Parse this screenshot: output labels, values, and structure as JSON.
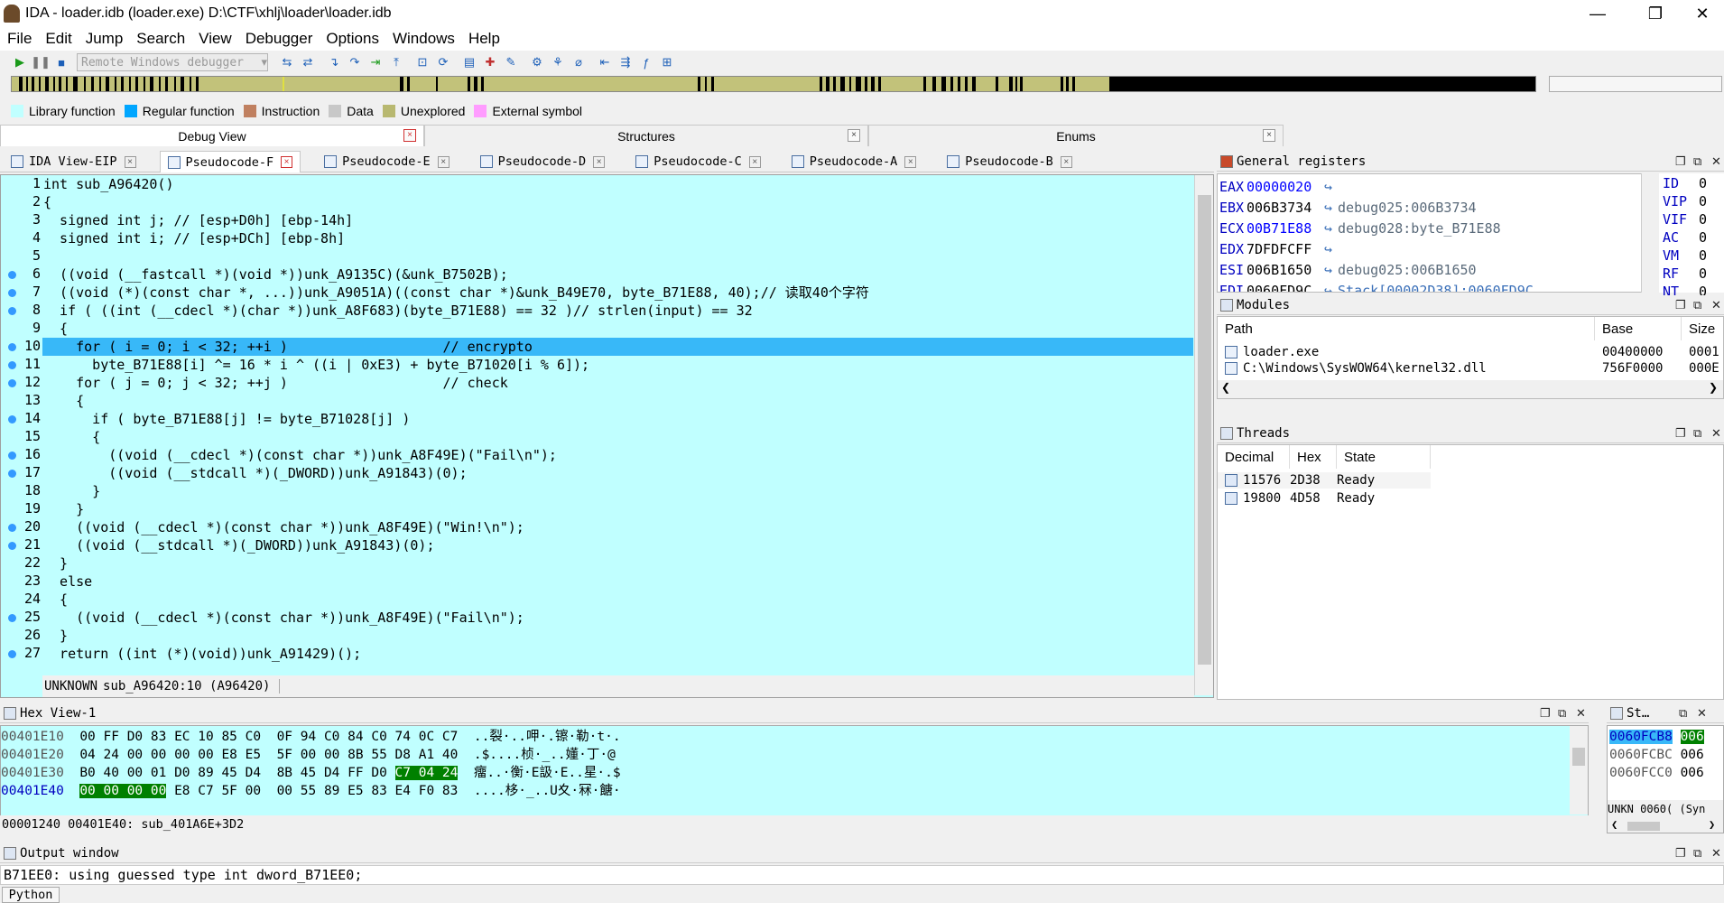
{
  "window": {
    "title": "IDA - loader.idb (loader.exe) D:\\CTF\\xhlj\\loader\\loader.idb",
    "minimize": "—",
    "maximize": "❐",
    "close": "✕"
  },
  "menu": [
    "File",
    "Edit",
    "Jump",
    "Search",
    "View",
    "Debugger",
    "Options",
    "Windows",
    "Help"
  ],
  "toolbar": {
    "debugger_select": "Remote Windows debugger"
  },
  "legend": [
    {
      "label": "Library function",
      "color": "#c0ffff"
    },
    {
      "label": "Regular function",
      "color": "#00a6ff"
    },
    {
      "label": "Instruction",
      "color": "#c08060"
    },
    {
      "label": "Data",
      "color": "#c8c8c8"
    },
    {
      "label": "Unexplored",
      "color": "#b8b870"
    },
    {
      "label": "External symbol",
      "color": "#ff9cff"
    }
  ],
  "top_tabs": [
    "Debug View",
    "Structures",
    "Enums"
  ],
  "code_tabs": [
    "IDA View-EIP",
    "Pseudocode-F",
    "Pseudocode-E",
    "Pseudocode-D",
    "Pseudocode-C",
    "Pseudocode-A",
    "Pseudocode-B"
  ],
  "code_lines": [
    "int sub_A96420()",
    "{",
    "  signed int j; // [esp+D0h] [ebp-14h]",
    "  signed int i; // [esp+DCh] [ebp-8h]",
    "",
    "  ((void (__fastcall *)(void *))unk_A9135C)(&unk_B7502B);",
    "  ((void (*)(const char *, ...))unk_A9051A)((const char *)&unk_B49E70, byte_B71E88, 40);// 读取40个字符",
    "  if ( ((int (__cdecl *)(char *))unk_A8F683)(byte_B71E88) == 32 )// strlen(input) == 32",
    "  {",
    "    for ( i = 0; i < 32; ++i )                   // encrypto",
    "      byte_B71E88[i] ^= 16 * i ^ ((i | 0xE3) + byte_B71020[i % 6]);",
    "    for ( j = 0; j < 32; ++j )                   // check",
    "    {",
    "      if ( byte_B71E88[j] != byte_B71028[j] )",
    "      {",
    "        ((void (__cdecl *)(const char *))unk_A8F49E)(\"Fail\\n\");",
    "        ((void (__stdcall *)(_DWORD))unk_A91843)(0);",
    "      }",
    "    }",
    "    ((void (__cdecl *)(const char *))unk_A8F49E)(\"Win!\\n\");",
    "    ((void (__stdcall *)(_DWORD))unk_A91843)(0);",
    "  }",
    "  else",
    "  {",
    "    ((void (__cdecl *)(const char *))unk_A8F49E)(\"Fail\\n\");",
    "  }",
    "  return ((int (*)(void))unk_A91429)();"
  ],
  "code_status": {
    "state": "UNKNOWN",
    "location": "sub_A96420:10 (A96420)"
  },
  "registers_title": "General registers",
  "registers": [
    {
      "name": "EAX",
      "value": "00000020",
      "desc": ""
    },
    {
      "name": "EBX",
      "value": "006B3734",
      "desc": "debug025:006B3734"
    },
    {
      "name": "ECX",
      "value": "00B71E88",
      "desc": "debug028:byte_B71E88"
    },
    {
      "name": "EDX",
      "value": "7DFDFCFF",
      "desc": ""
    },
    {
      "name": "ESI",
      "value": "006B1650",
      "desc": "debug025:006B1650"
    },
    {
      "name": "EDI",
      "value": "0060FD9C",
      "desc": "Stack[00002D38]:0060FD9C"
    }
  ],
  "flags": [
    {
      "name": "ID",
      "value": "0"
    },
    {
      "name": "VIP",
      "value": "0"
    },
    {
      "name": "VIF",
      "value": "0"
    },
    {
      "name": "AC",
      "value": "0"
    },
    {
      "name": "VM",
      "value": "0"
    },
    {
      "name": "RF",
      "value": "0"
    },
    {
      "name": "NT",
      "value": "0"
    }
  ],
  "modules_title": "Modules",
  "modules_columns": [
    "Path",
    "Base",
    "Size"
  ],
  "modules": [
    {
      "path": "loader.exe",
      "base": "00400000",
      "size": "0001"
    },
    {
      "path": "C:\\Windows\\SysWOW64\\kernel32.dll",
      "base": "756F0000",
      "size": "000E"
    }
  ],
  "threads_title": "Threads",
  "threads_columns": [
    "Decimal",
    "Hex",
    "State"
  ],
  "threads": [
    {
      "dec": "11576",
      "hex": "2D38",
      "state": "Ready"
    },
    {
      "dec": "19800",
      "hex": "4D58",
      "state": "Ready"
    }
  ],
  "hex_title": "Hex View-1",
  "hex_rows": [
    {
      "addr": "00401E10",
      "b1": "00 FF D0 83 EC 10 85 C0",
      "b2": "0F 94 C0 84 C0 74 0C C7",
      "ascii": "..裂·..呷·.镲·勒·t·."
    },
    {
      "addr": "00401E20",
      "b1": "04 24 00 00 00 00 E8 E5",
      "b2": "5F 00 00 8B 55 D8 A1 40",
      "ascii": ".$....桢·_..嬞·丁·@"
    },
    {
      "addr": "00401E30",
      "b1": "B0 40 00 01 D0 89 45 D4",
      "b2": "8B 45 D4 FF D0",
      "sel": "C7 04 24",
      "ascii": "癅..·衡·E訯·E..星·.$"
    },
    {
      "addr": "00401E40",
      "selstart": "00 00 00 00",
      "b1rest": "E8 C7 5F 00",
      "b2": "00 55 89 E5 83 E4 F0 83",
      "ascii": "....栘·_..U夊·冧·餹·"
    }
  ],
  "hex_status": "00001240 00401E40: sub_401A6E+3D2",
  "stack_title": "St…",
  "stack_rows": [
    {
      "addr": "0060FCB8",
      "val": "006"
    },
    {
      "addr": "0060FCBC",
      "val": "006"
    },
    {
      "addr": "0060FCC0",
      "val": "006"
    }
  ],
  "stack_status": "UNKN 0060( (Syn",
  "output_title": "Output window",
  "output_text": "B71EE0: using guessed type int dword_B71EE0;",
  "python_button": "Python"
}
